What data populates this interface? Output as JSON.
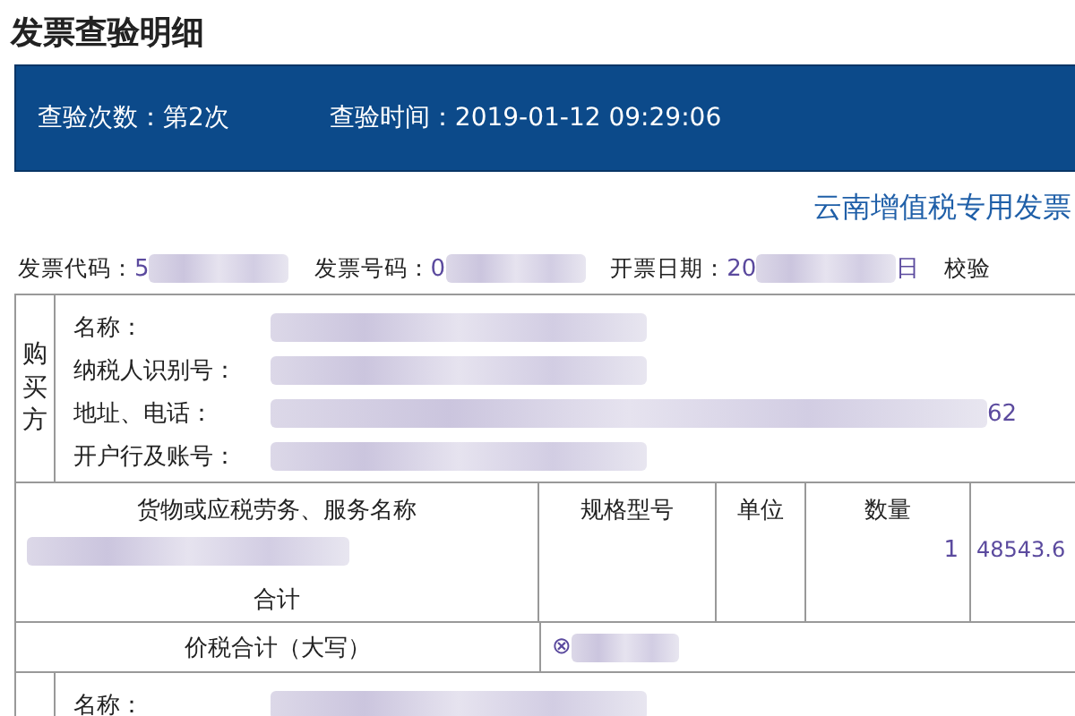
{
  "page_title": "发票查验明细",
  "summary": [
    "查验次数：第2次",
    "查验时间：2019-01-12 09:29:06"
  ],
  "invoice_type": "云南增值税专用发票",
  "meta": [
    {
      "label": "发票代码：",
      "value": "5"
    },
    {
      "label": "发票号码：",
      "value": "0"
    },
    {
      "label": "开票日期：",
      "value": "20",
      "value_end": "日"
    },
    {
      "label": "校验"
    }
  ],
  "buyer": {
    "side_label": "购买方",
    "fields": [
      {
        "label": "名称："
      },
      {
        "label": "纳税人识别号："
      },
      {
        "label": "地址、电话：",
        "value_end": "62"
      },
      {
        "label": "开户行及账号："
      }
    ]
  },
  "goods": {
    "columns": [
      "货物或应税劳务、服务名称",
      "规格型号",
      "单位",
      "数量"
    ],
    "quantity": "1",
    "unit_price": "48543.6",
    "total_label": "合计"
  },
  "amount_in_words": {
    "label": "价税合计（大写）",
    "prefix": "⊗"
  },
  "seller": {
    "fields": [
      {
        "label": "名称："
      }
    ]
  }
}
